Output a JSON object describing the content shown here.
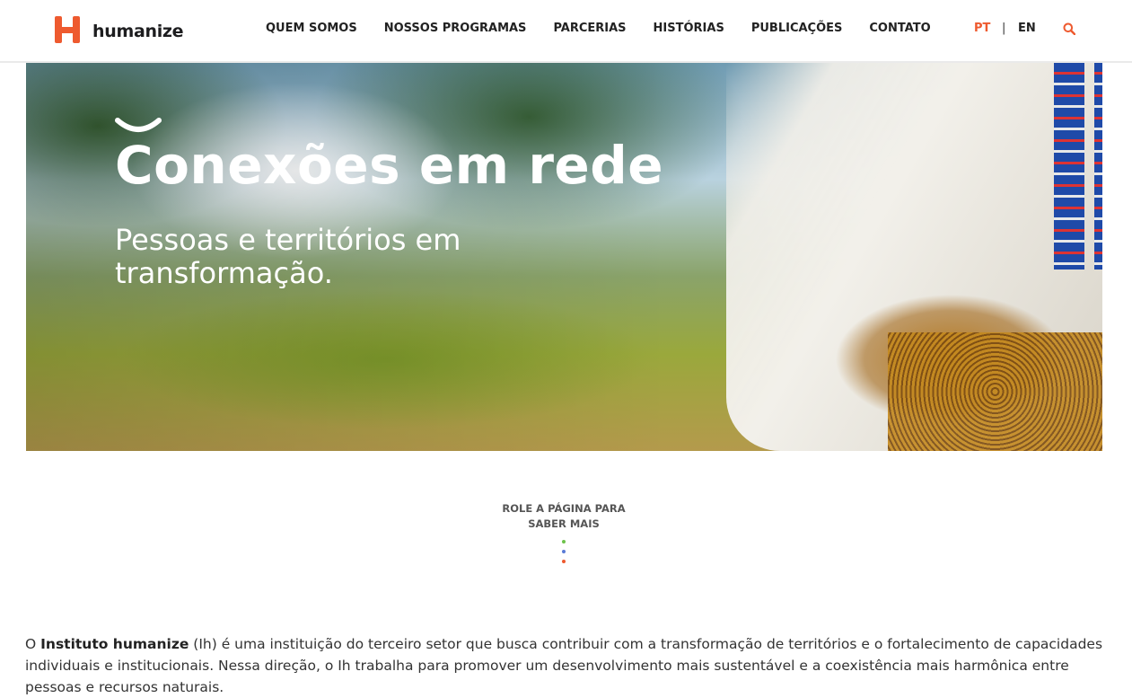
{
  "header": {
    "logo_text": "humanize",
    "nav": [
      {
        "label": "QUEM SOMOS"
      },
      {
        "label": "NOSSOS PROGRAMAS"
      },
      {
        "label": "PARCERIAS"
      },
      {
        "label": "HISTÓRIAS"
      },
      {
        "label": "PUBLICAÇÕES"
      },
      {
        "label": "CONTATO"
      }
    ],
    "lang_pt": "PT",
    "lang_sep": "|",
    "lang_en": "EN",
    "search_icon": "search-icon",
    "accent_color": "#ee5a2f"
  },
  "hero": {
    "title": "Conexões em rede",
    "subtitle": "Pessoas e territórios em transformação."
  },
  "scroll_cue": {
    "text": "ROLE A PÁGINA PARA SABER MAIS",
    "dot_colors": [
      "#6cc24a",
      "#5a7bd6",
      "#ee5a2f"
    ]
  },
  "intro": {
    "prefix": "O ",
    "bold": "Instituto humanize",
    "rest": " (Ih) é uma instituição do terceiro setor que busca contribuir com a transformação de territórios e o fortalecimento de capacidades individuais e institucionais. Nessa direção, o Ih trabalha para promover um desenvolvimento mais sustentável e a coexistência mais harmônica entre pessoas e recursos naturais."
  }
}
